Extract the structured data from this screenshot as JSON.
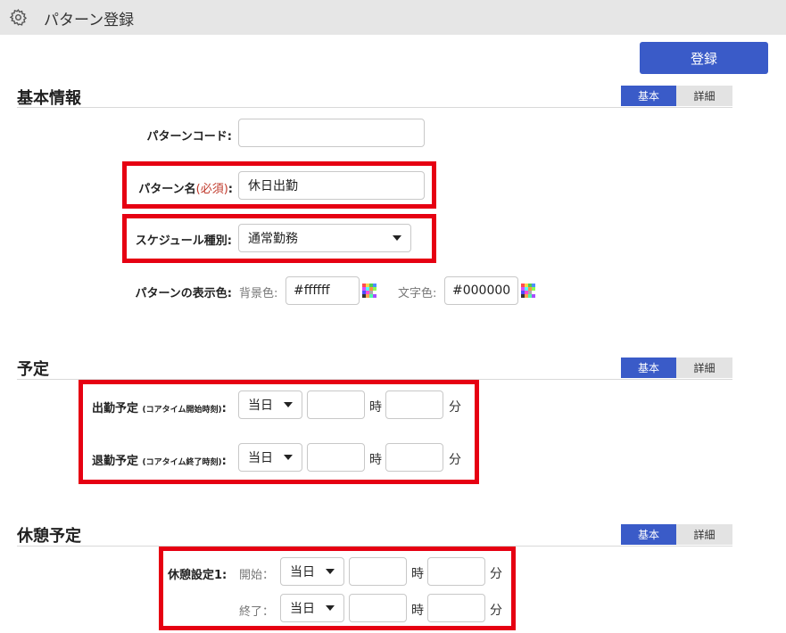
{
  "header": {
    "title": "パターン登録",
    "icon": "gear-icon"
  },
  "actions": {
    "register_label": "登録"
  },
  "toggle": {
    "basic": "基本",
    "detail": "詳細"
  },
  "basic_info": {
    "title": "基本情報",
    "pattern_code_label": "パターンコード:",
    "pattern_code_value": "",
    "pattern_name_label": "パターン名",
    "pattern_name_required": "(必須)",
    "pattern_name_colon": ":",
    "pattern_name_value": "休日出勤",
    "schedule_type_label": "スケジュール種別:",
    "schedule_type_value": "通常勤務",
    "display_color_label": "パターンの表示色:",
    "bg_color_label": "背景色:",
    "bg_color_value": "#ffffff",
    "text_color_label": "文字色:",
    "text_color_value": "#000000"
  },
  "schedule": {
    "title": "予定",
    "start_label": "出勤予定",
    "start_note": "(コアタイム開始時刻)",
    "start_day": "当日",
    "end_label": "退勤予定",
    "end_note": "(コアタイム終了時刻)",
    "end_day": "当日",
    "colon": ":",
    "hour_unit": "時",
    "minute_unit": "分"
  },
  "break": {
    "title": "休憩予定",
    "setting_label": "休憩設定1:",
    "start_label": "開始：",
    "end_label": "終了：",
    "start_day": "当日",
    "end_day": "当日",
    "hour_unit": "時",
    "minute_unit": "分"
  },
  "colors": {
    "accent": "#3a5bc8",
    "highlight": "#e60012",
    "required": "#c0392b"
  }
}
